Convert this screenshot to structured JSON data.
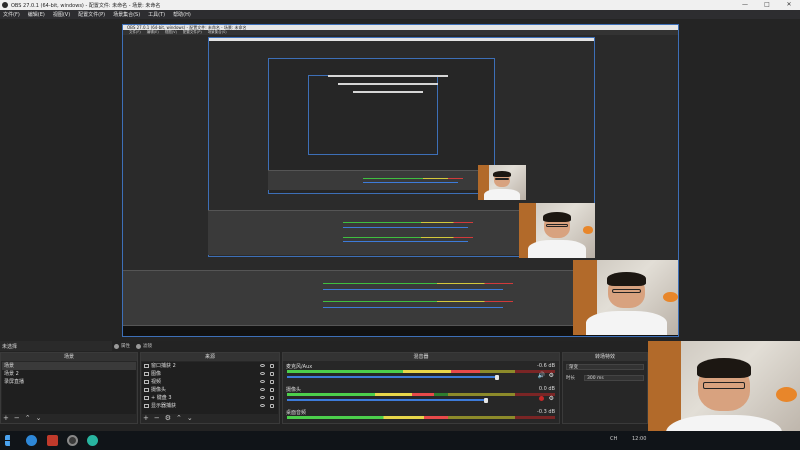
{
  "window": {
    "title": "OBS 27.0.1 (64-bit, windows) - 配置文件: 未命名 - 场景: 未命名",
    "min_label": "—",
    "max_label": "□",
    "close_label": "✕"
  },
  "menu": [
    "文件(F)",
    "编辑(E)",
    "视图(V)",
    "配置文件(P)",
    "场景集合(S)",
    "工具(T)",
    "帮助(H)"
  ],
  "dock": {
    "scene_header": "未选择",
    "filter_btn": "属性",
    "filters_btn": "滤镜",
    "scenes": {
      "title": "场景",
      "items": [
        "场景",
        "场景 2",
        "录屏直播"
      ],
      "selected": 0
    },
    "sources": {
      "title": "来源",
      "items": [
        "窗口捕获 2",
        "图像",
        "视频",
        "摄像头",
        "+ 键盘 3",
        "显示器捕获"
      ]
    },
    "mixer": {
      "title": "混音器",
      "channels": [
        {
          "name": "麦克风/Aux",
          "db": "-0.6 dB",
          "level": 0.72,
          "volume": 0.92
        },
        {
          "name": "摄像头",
          "db": "0.0 dB",
          "level": 0.55,
          "volume": 0.88
        },
        {
          "name": "桌面音频",
          "db": "-0.3 dB",
          "level": 0.6,
          "volume": 0.9
        }
      ]
    },
    "transitions": {
      "title": "转场特效",
      "type": "渐变",
      "duration_label": "时长",
      "duration_value": "300 ms"
    }
  },
  "taskbar": {
    "tray_text": "CH",
    "time": "12:00"
  },
  "colors": {
    "accent": "#3d6fb7",
    "meter_green": "#4ccf4c",
    "meter_yellow": "#e7d64a",
    "meter_red": "#e84a4a",
    "slider_blue": "#3d7bd9"
  }
}
